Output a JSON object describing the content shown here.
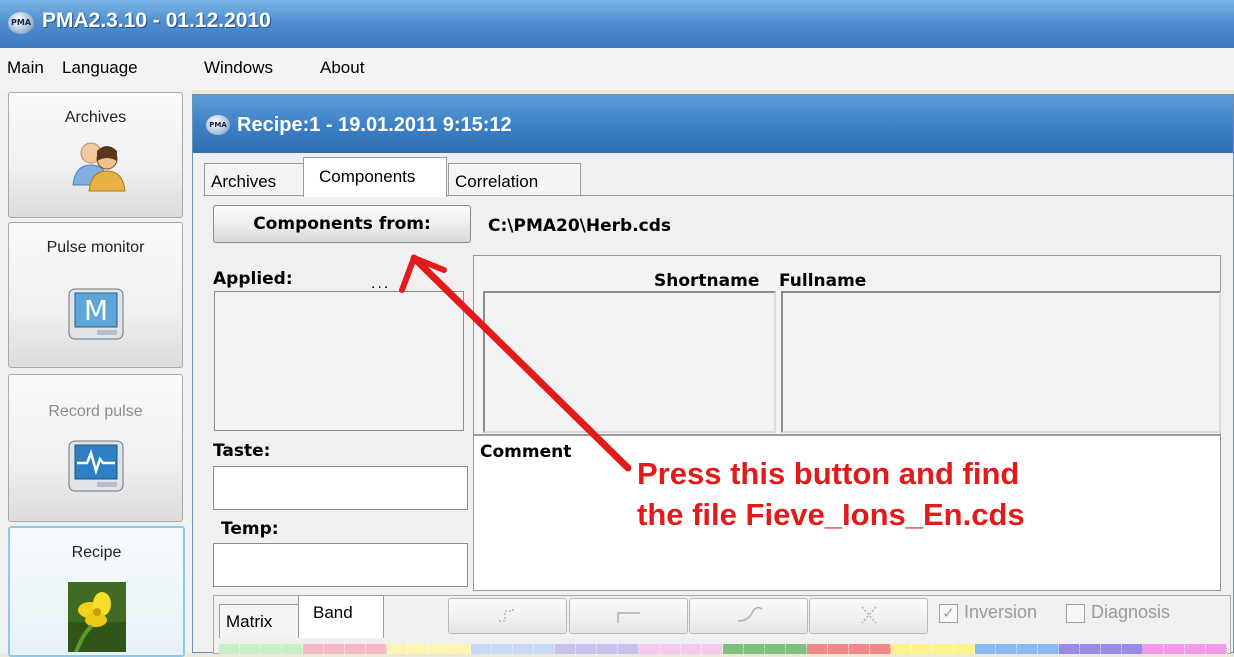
{
  "app": {
    "title": "PMA2.3.10 - 01.12.2010",
    "logo_text": "PMA"
  },
  "menu": [
    "Main",
    "Language",
    "Windows",
    "About"
  ],
  "leftnav": [
    {
      "label": "Archives",
      "icon": "users-icon",
      "state": "normal"
    },
    {
      "label": "Pulse monitor",
      "icon": "monitor-m-icon",
      "state": "normal"
    },
    {
      "label": "Record pulse",
      "icon": "heartbeat-monitor-icon",
      "state": "disabled"
    },
    {
      "label": "Recipe",
      "icon": "flower-icon",
      "state": "active"
    }
  ],
  "recipe_window": {
    "title": "Recipe:1 - 19.01.2011 9:15:12",
    "tabs": [
      "Archives",
      "Components",
      "Correlation"
    ],
    "selected_tab": "Components",
    "components_button": "Components from:",
    "path": "C:\\PMA20\\Herb.cds",
    "applied_label": "Applied:",
    "applied_dots": "...",
    "shortname_header": "Shortname",
    "fullname_header": "Fullname",
    "taste_label": "Taste:",
    "temp_label": "Temp:",
    "comment_label": "Comment",
    "bottom_tabs": [
      "Matrix",
      "Band"
    ],
    "selected_bottom_tab": "Band",
    "toolbar_icons": [
      "step-up-icon",
      "step-flat-icon",
      "curve-icon",
      "scatter-icon"
    ],
    "inversion_label": "Inversion",
    "inversion_checked": true,
    "diagnosis_label": "Diagnosis",
    "diagnosis_checked": false
  },
  "annotation": {
    "line1": "Press this button and find",
    "line2": "the file Fieve_Ions_En.cds",
    "color": "#e31a1a"
  },
  "colors": {
    "title_blue": "#3b79bf",
    "band": [
      "#c8f0c8",
      "#f7b8c8",
      "#fff5b0",
      "#c6d8f7",
      "#c9c0f0",
      "#f5c9f0",
      "#7fc07f",
      "#f08a8a",
      "#fff28a",
      "#8ab8f0",
      "#9a8ae8",
      "#f09ae8"
    ]
  }
}
